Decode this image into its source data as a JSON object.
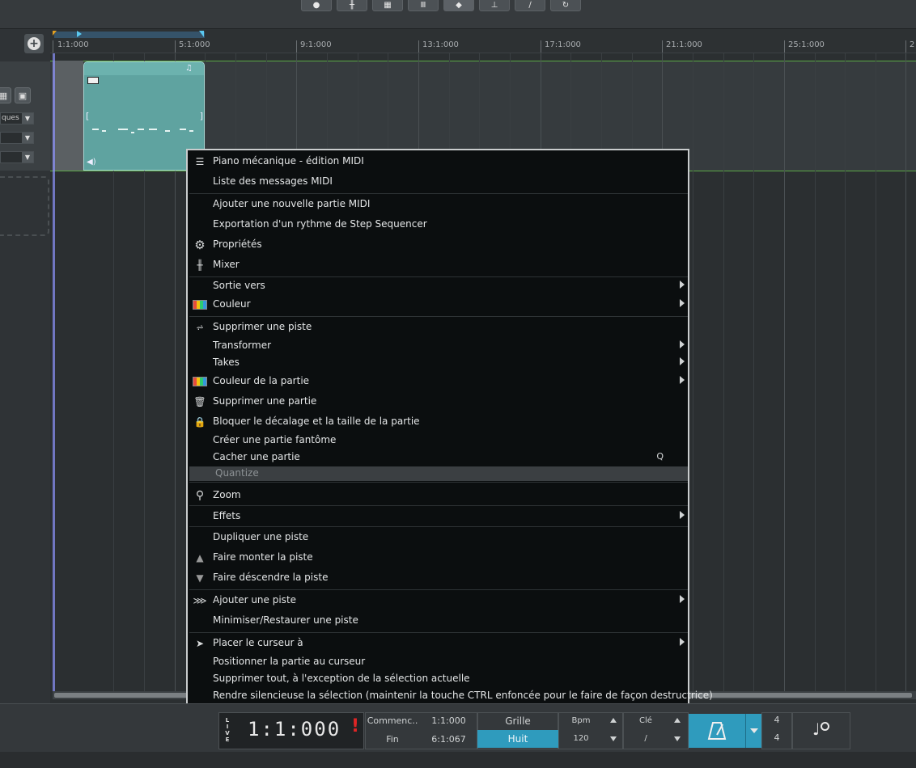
{
  "toolbar": {
    "icons": [
      "info-icon",
      "mixer-icon",
      "grid-icon",
      "keyboard-icon",
      "marker-icon",
      "insert-icon",
      "wand-icon",
      "loop-icon"
    ]
  },
  "ruler": {
    "marks": [
      "1:1:000",
      "5:1:000",
      "9:1:000",
      "13:1:000",
      "17:1:000",
      "21:1:000",
      "25:1:000",
      "2"
    ]
  },
  "track_header": {
    "drop1": "ques"
  },
  "context_menu": {
    "items": [
      {
        "label": "Piano mécanique - édition MIDI",
        "icon": "piano-roll-icon"
      },
      {
        "label": "Liste des messages MIDI"
      },
      {
        "label": "Ajouter une nouvelle partie MIDI"
      },
      {
        "label": "Exportation d'un rythme de Step Sequencer"
      },
      {
        "label": "Propriétés",
        "icon": "gear-icon"
      },
      {
        "label": "Mixer",
        "icon": "mixer-icon"
      },
      {
        "label": "Sortie vers",
        "submenu": true
      },
      {
        "label": "Couleur",
        "icon": "color-icon",
        "submenu": true
      },
      {
        "label": "Supprimer une piste",
        "icon": "delete-track-icon"
      },
      {
        "label": "Transformer",
        "submenu": true
      },
      {
        "label": "Takes",
        "submenu": true
      },
      {
        "label": "Couleur de la partie",
        "icon": "color-icon",
        "submenu": true
      },
      {
        "label": "Supprimer une partie",
        "icon": "trash-icon"
      },
      {
        "label": "Bloquer le décalage et la taille de la partie",
        "icon": "lock-icon"
      },
      {
        "label": "Créer une partie fantôme"
      },
      {
        "label": "Cacher une partie",
        "shortcut": "Q"
      },
      {
        "label": "Quantize",
        "disabled": true
      },
      {
        "label": "Zoom",
        "icon": "zoom-icon"
      },
      {
        "label": "Effets",
        "submenu": true
      },
      {
        "label": "Dupliquer une piste"
      },
      {
        "label": "Faire monter la piste",
        "icon": "up-icon"
      },
      {
        "label": "Faire déscendre la piste",
        "icon": "down-icon"
      },
      {
        "label": "Ajouter une piste",
        "icon": "add-track-icon",
        "submenu": true
      },
      {
        "label": "Minimiser/Restaurer une piste"
      },
      {
        "label": "Placer le curseur à",
        "icon": "cursor-icon",
        "submenu": true
      },
      {
        "label": "Positionner la partie au curseur"
      },
      {
        "label": "Supprimer tout, à l'exception de la sélection actuelle"
      },
      {
        "label": "Rendre silencieuse la sélection (maintenir la touche CTRL enfoncée pour le faire de façon destructrice)"
      }
    ]
  },
  "transport": {
    "live": "LIVE",
    "time": "1:1:000",
    "warning": "!",
    "start_label": "Commenc..",
    "start_value": "1:1:000",
    "end_label": "Fin",
    "end_value": "6:1:067",
    "grid_label": "Grille",
    "grid_value": "Huit",
    "bpm_label": "Bpm",
    "bpm_value": "120",
    "key_label": "Clé",
    "key_value": "/",
    "sig_top": "4",
    "sig_bottom": "4",
    "accent_color": "#2f9bbd"
  }
}
